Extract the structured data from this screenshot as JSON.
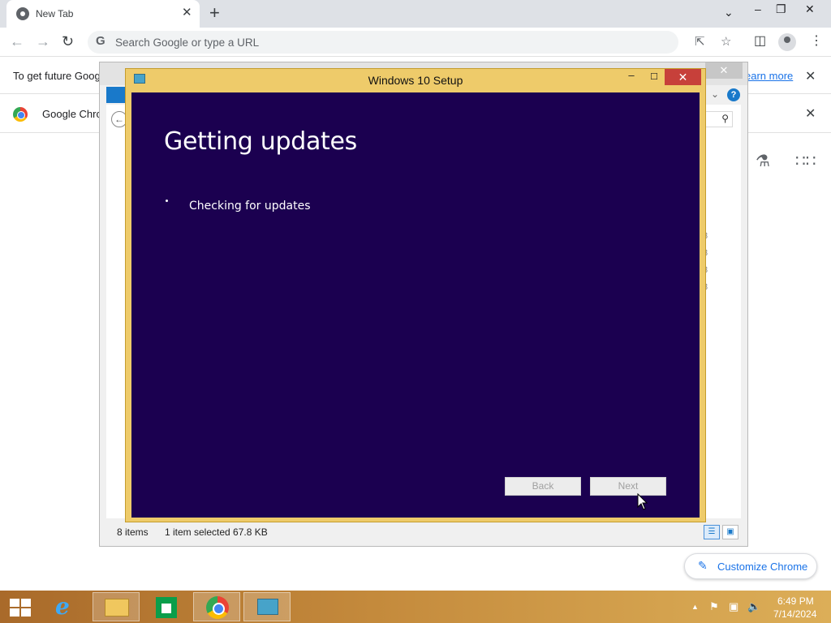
{
  "browser": {
    "tab": {
      "title": "New Tab",
      "close": "✕"
    },
    "new_tab": "+",
    "window_controls": {
      "dropdown": "⌄",
      "minimize": "–",
      "restore": "❐",
      "close": "✕"
    },
    "omnibox": {
      "placeholder": "Search Google or type a URL",
      "g_letter": "G"
    },
    "infobar1": {
      "text": "To get future Goog",
      "link": "earn more",
      "close": "✕"
    },
    "infobar2": {
      "text": "Google Chro",
      "close": "✕"
    },
    "customize": {
      "label": "Customize Chrome"
    }
  },
  "explorer": {
    "status": {
      "items": "8 items",
      "selected": "1 item selected  67.8 KB"
    },
    "side_numbers": [
      "3",
      "3",
      "3",
      "3"
    ],
    "close": "✕",
    "help": "?"
  },
  "setup": {
    "title": "Windows 10 Setup",
    "minimize": "–",
    "maximize": "☐",
    "close": "✕",
    "heading": "Getting updates",
    "status": "Checking for updates",
    "back_label": "Back",
    "next_label": "Next"
  },
  "taskbar": {
    "time": "6:49 PM",
    "date": "7/14/2024",
    "tray": {
      "chevron": "▲",
      "flag": "⚑",
      "network": "▣",
      "volume": "🔈"
    }
  },
  "colors": {
    "setup_background": "#1b0050",
    "setup_frame": "#eecb6a",
    "close_red": "#c7403a",
    "link_blue": "#1a73e8"
  }
}
